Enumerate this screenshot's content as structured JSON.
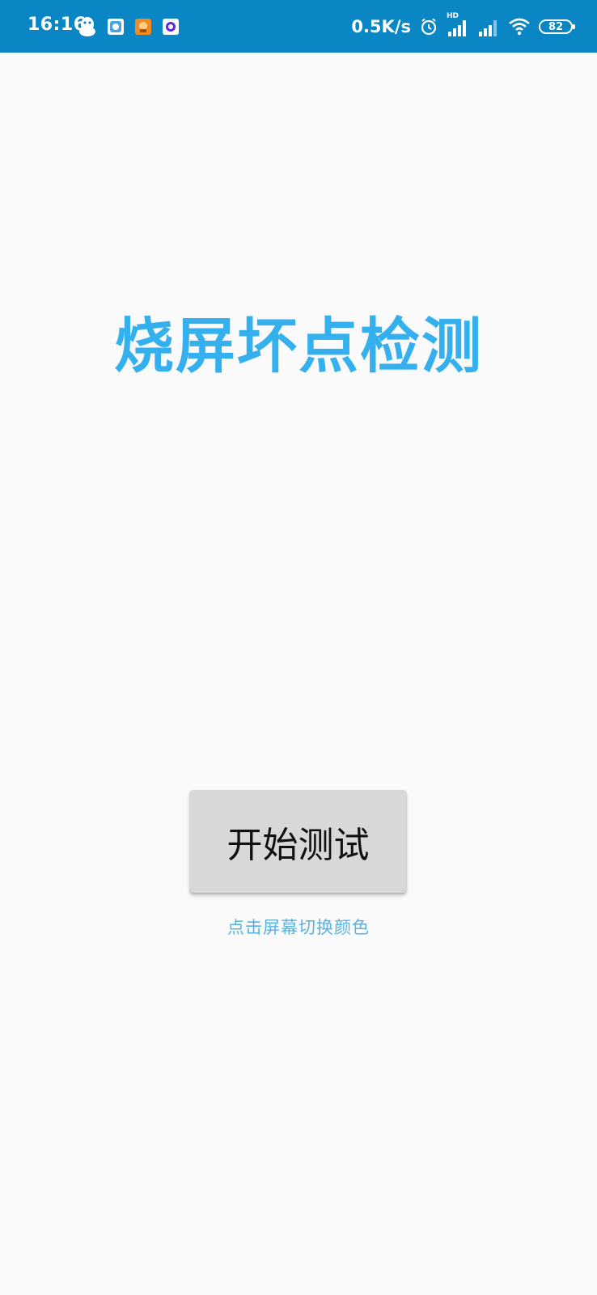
{
  "status_bar": {
    "time": "16:16",
    "network_speed": "0.5K/s",
    "network_type": "HD",
    "battery_level": "82",
    "background_color": "#0a86c4",
    "left_icons": [
      "qq-icon",
      "app-icon-blue",
      "app-icon-orange",
      "app-icon-purple"
    ],
    "right_icons": [
      "alarm-icon",
      "signal-hd-icon",
      "signal-icon",
      "wifi-icon",
      "battery-icon"
    ]
  },
  "main": {
    "title": "烧屏坏点检测",
    "title_color": "#35b0ee",
    "start_button_label": "开始测试",
    "hint": "点击屏幕切换颜色",
    "hint_color": "#54b4e2"
  }
}
